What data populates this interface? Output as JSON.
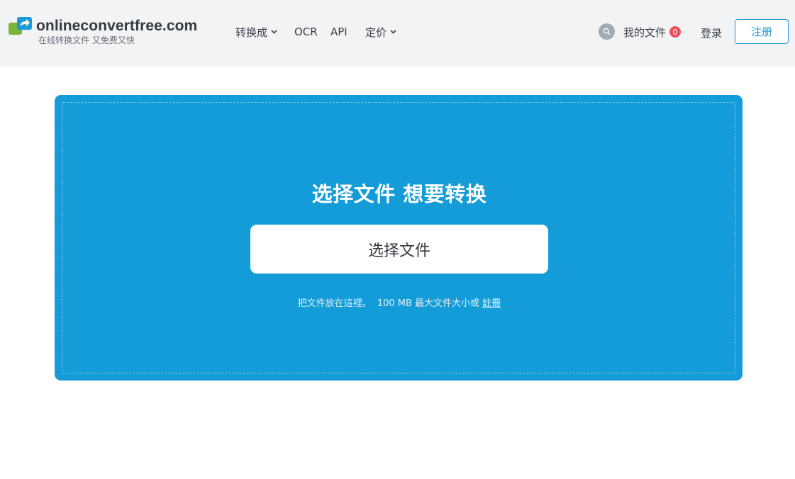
{
  "header": {
    "logo_name": "onlineconvertfree.com",
    "logo_tagline": "在线转换文件 又免费又快",
    "nav": {
      "convert_to": "转换成",
      "ocr": "OCR",
      "api": "API",
      "pricing": "定价"
    },
    "my_files_label": "我的文件",
    "my_files_count": "0",
    "login_label": "登录",
    "register_label": "注册"
  },
  "upload": {
    "title": "选择文件 想要转换",
    "choose_button": "选择文件",
    "hint_drop": "把文件放在這裡。",
    "hint_limit": "100 MB 最大文件大小或",
    "hint_register_link": "註冊"
  },
  "colors": {
    "brand_blue": "#149cd8",
    "header_bg": "#f2f3f5",
    "badge_red": "#f0505a",
    "logo_green": "#7ab53a"
  },
  "icons": {
    "logo": "logo-convert-arrows-icon",
    "search": "search-icon",
    "dropdown": "chevron-down-icon"
  }
}
